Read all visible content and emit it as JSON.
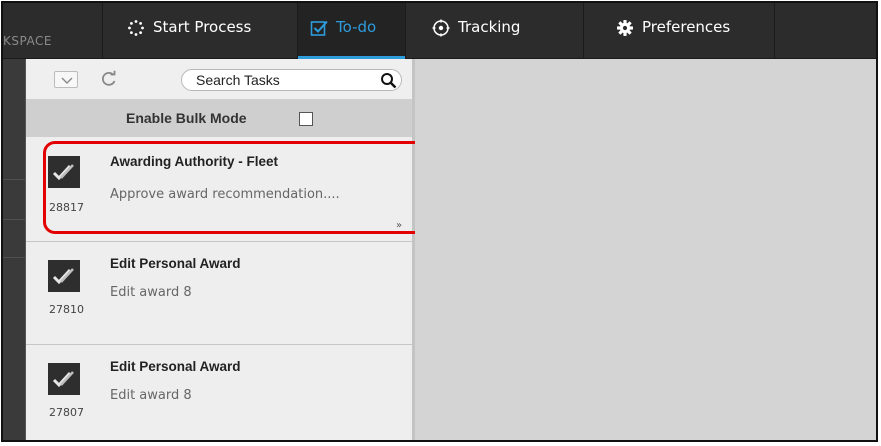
{
  "workspace_label": "KSPACE",
  "nav": {
    "items": [
      {
        "label": "Start Process",
        "icon": "start-process-icon"
      },
      {
        "label": "To-do",
        "icon": "todo-checkbox-icon",
        "active": true
      },
      {
        "label": "Tracking",
        "icon": "tracking-icon"
      },
      {
        "label": "Preferences",
        "icon": "gear-icon"
      }
    ],
    "active_color": "#2e9cdb"
  },
  "tasks_panel": {
    "search_placeholder": "Search Tasks",
    "bulk_mode_label": "Enable Bulk Mode",
    "bulk_mode_checked": false,
    "tasks": [
      {
        "id": "28817",
        "title": "Awarding Authority - Fleet",
        "description": "Approve award recommendation....",
        "highlighted": true,
        "expander": "»"
      },
      {
        "id": "27810",
        "title": "Edit Personal Award",
        "description": "Edit award 8"
      },
      {
        "id": "27807",
        "title": "Edit Personal Award",
        "description": "Edit award 8"
      }
    ]
  },
  "highlight_color": "#e30000"
}
